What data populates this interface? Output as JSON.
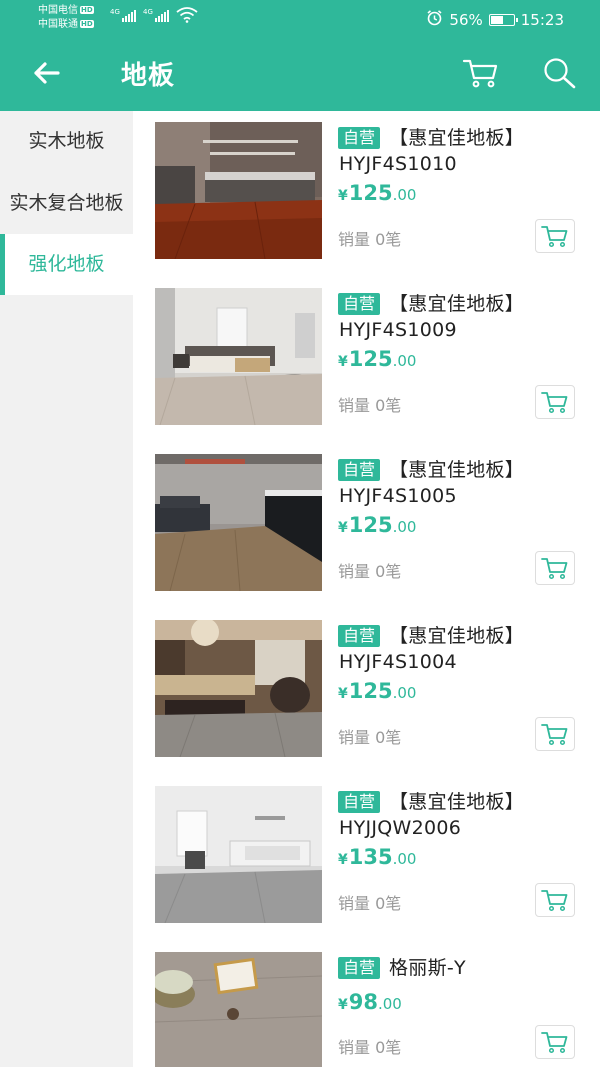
{
  "status": {
    "carrier1": "中国电信",
    "carrier2": "中国联通",
    "hd": "HD",
    "net1": "4G",
    "net2": "4G",
    "battery_text": "56%",
    "battery_level": 0.56,
    "time": "15:23"
  },
  "header": {
    "title": "地板",
    "back_icon": "arrow-left-icon",
    "cart_icon": "cart-icon",
    "search_icon": "search-icon"
  },
  "colors": {
    "accent": "#2fb89a",
    "sidebar_bg": "#f1f1f1",
    "muted_text": "#999999"
  },
  "sidebar": {
    "items": [
      {
        "label": "实木地板",
        "active": false
      },
      {
        "label": "实木复合地板",
        "active": false
      },
      {
        "label": "强化地板",
        "active": true
      }
    ]
  },
  "products": [
    {
      "tag": "自营",
      "name": "【惠宜佳地板】HYJF4S1010",
      "currency": "¥",
      "price_int": "125",
      "price_dec": ".00",
      "sales": "销量 0笔"
    },
    {
      "tag": "自营",
      "name": "【惠宜佳地板】HYJF4S1009",
      "currency": "¥",
      "price_int": "125",
      "price_dec": ".00",
      "sales": "销量 0笔"
    },
    {
      "tag": "自营",
      "name": "【惠宜佳地板】HYJF4S1005",
      "currency": "¥",
      "price_int": "125",
      "price_dec": ".00",
      "sales": "销量 0笔"
    },
    {
      "tag": "自营",
      "name": "【惠宜佳地板】HYJF4S1004",
      "currency": "¥",
      "price_int": "125",
      "price_dec": ".00",
      "sales": "销量 0笔"
    },
    {
      "tag": "自营",
      "name": "【惠宜佳地板】HYJJQW2006",
      "currency": "¥",
      "price_int": "135",
      "price_dec": ".00",
      "sales": "销量 0笔"
    },
    {
      "tag": "自营",
      "name": "格丽斯-Y",
      "currency": "¥",
      "price_int": "98",
      "price_dec": ".00",
      "sales": "销量 0笔"
    }
  ]
}
